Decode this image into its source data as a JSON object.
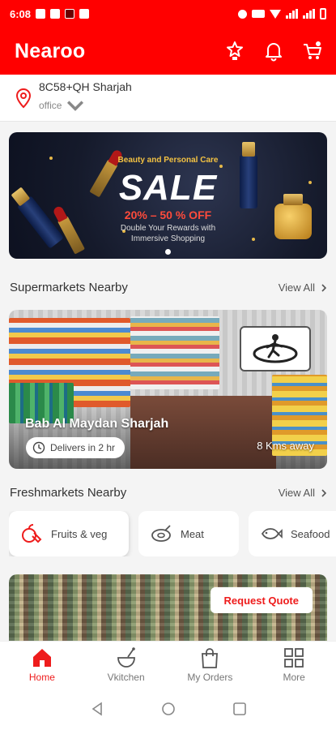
{
  "status_bar": {
    "time": "6:08"
  },
  "header": {
    "brand": "Nearoo",
    "icons": [
      "trophy-icon",
      "bell-icon",
      "cart-icon"
    ]
  },
  "location": {
    "address": "8C58+QH Sharjah",
    "label": "office",
    "icon": "location-pin-icon"
  },
  "banner": {
    "category": "Beauty and Personal Care",
    "headline": "SALE",
    "discount": "20% – 50 % OFF",
    "line1": "Double Your Rewards with",
    "line2": "Immersive Shopping"
  },
  "supermarkets": {
    "title": "Supermarkets Nearby",
    "view_all": "View All",
    "store": {
      "name": "Bab Al Maydan Sharjah",
      "delivery": "Delivers in 2 hr",
      "distance": "8 Kms away"
    }
  },
  "freshmarkets": {
    "title": "Freshmarkets Nearby",
    "view_all": "View All",
    "categories": [
      {
        "label": "Fruits & veg",
        "icon": "fruits-icon"
      },
      {
        "label": "Meat",
        "icon": "meat-icon"
      },
      {
        "label": "Seafood",
        "icon": "fish-icon"
      }
    ],
    "quote_button": "Request Quote"
  },
  "bottom_nav": [
    {
      "label": "Home",
      "icon": "home-icon",
      "active": true
    },
    {
      "label": "Vkitchen",
      "icon": "kitchen-icon",
      "active": false
    },
    {
      "label": "My Orders",
      "icon": "bag-icon",
      "active": false
    },
    {
      "label": "More",
      "icon": "grid-icon",
      "active": false
    }
  ],
  "colors": {
    "brand_red": "#ff0000",
    "accent_red": "#ee1c1c",
    "background": "#f4f4f4"
  }
}
